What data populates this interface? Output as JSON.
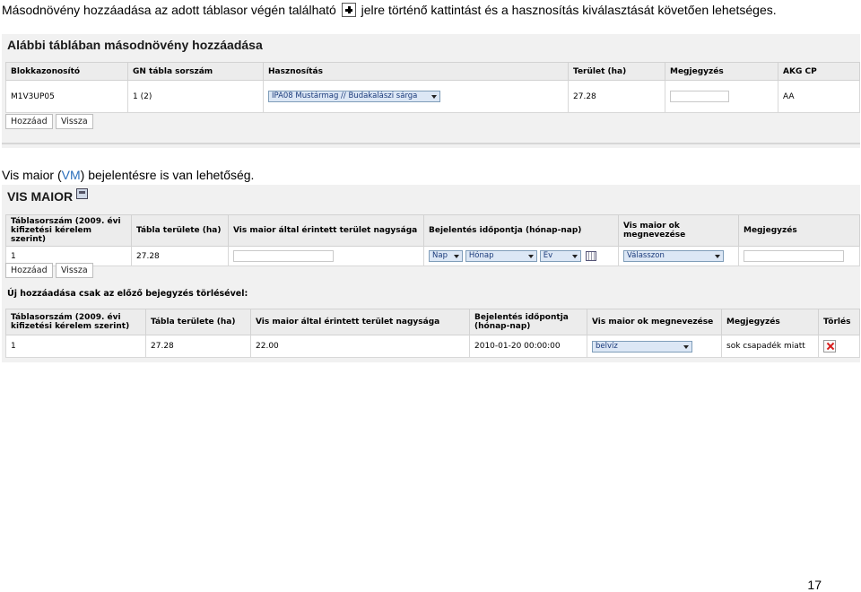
{
  "intro": {
    "before_icon": "Másodnövény hozzáadása az adott táblasor végén található",
    "icon": "plus-icon",
    "after_icon": "jelre történő kattintást és a hasznosítás kiválasztását követően lehetséges."
  },
  "second_crop": {
    "title": "Alábbi táblában másodnövény hozzáadása",
    "columns": [
      "Blokkazonosító",
      "GN tábla sorszám",
      "Hasznosítás",
      "Terület (ha)",
      "Megjegyzés",
      "AKG CP"
    ],
    "row": {
      "block_id": "M1V3UP05",
      "gn_number": "1 (2)",
      "usage_selected": "IPA08 Mustármag // Budakalászi sárga",
      "area": "27.28",
      "note": "",
      "akg": "AA"
    },
    "buttons": {
      "add": "Hozzáad",
      "back": "Vissza"
    }
  },
  "vm_note": {
    "before": "Vis maior (",
    "abbr": "VM",
    "after": ") bejelentésre is van lehetőség."
  },
  "vis_maior": {
    "title": "VIS MAIOR",
    "title_icon": "document-icon",
    "form_columns": [
      "Táblasorszám (2009. évi kifizetési kérelem szerint)",
      "Tábla területe (ha)",
      "Vis maior által érintett terület nagysága",
      "Bejelentés időpontja (hónap-nap)",
      "Vis maior ok megnevezése",
      "Megjegyzés"
    ],
    "form_row": {
      "table_no": "1",
      "area": "27.28",
      "day_select": "Nap",
      "month_select": "Hónap",
      "year_select": "Év",
      "reason_select": "Válasszon"
    },
    "buttons": {
      "add": "Hozzáad",
      "back": "Vissza"
    },
    "new_entry_note": "Új hozzáadása csak az előző bejegyzés törlésével:",
    "existing_columns": [
      "Táblasorszám (2009. évi kifizetési kérelem szerint)",
      "Tábla területe (ha)",
      "Vis maior által érintett terület nagysága",
      "Bejelentés időpontja (hónap-nap)",
      "Vis maior ok megnevezése",
      "Megjegyzés",
      "Törlés"
    ],
    "existing_row": {
      "table_no": "1",
      "area": "27.28",
      "affected_area": "22.00",
      "date": "2010-01-20 00:00:00",
      "reason": "belvíz",
      "note": "sok csapadék miatt",
      "delete_icon": "delete-icon"
    }
  },
  "page_number": "17",
  "colors": {
    "select_bg": "#dce7f5",
    "header_bg": "#ececec",
    "delete_red": "#d81c1c",
    "vm_blue": "#2a6ebb"
  }
}
